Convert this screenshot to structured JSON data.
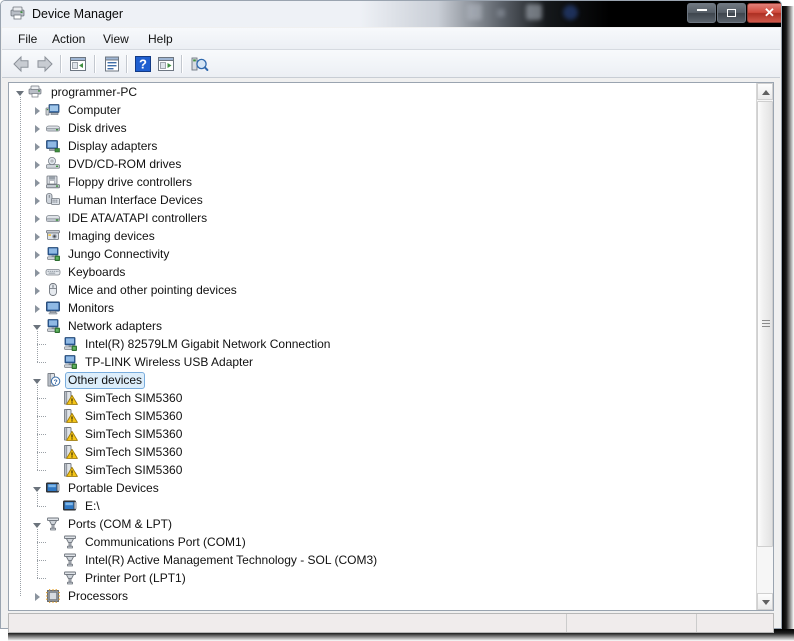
{
  "window": {
    "title": "Device Manager",
    "icon": "device-manager-icon",
    "controls": {
      "minimize": "minimize-button",
      "maximize": "maximize-button",
      "close": "close-button",
      "close_glyph": "✕"
    }
  },
  "menubar": {
    "items": [
      {
        "label": "File"
      },
      {
        "label": "Action"
      },
      {
        "label": "View"
      },
      {
        "label": "Help"
      }
    ]
  },
  "toolbar": {
    "buttons": [
      {
        "name": "back-button",
        "icon": "back-arrow-icon"
      },
      {
        "name": "forward-button",
        "icon": "forward-arrow-icon"
      },
      {
        "name": "show-hide-console-tree-button",
        "icon": "console-tree-icon"
      },
      {
        "name": "properties-button",
        "icon": "properties-icon"
      },
      {
        "name": "help-button",
        "icon": "help-question-icon"
      },
      {
        "name": "update-driver-button",
        "icon": "update-driver-icon"
      },
      {
        "name": "scan-for-hardware-changes-button",
        "icon": "scan-hardware-icon"
      }
    ]
  },
  "tree": {
    "root": {
      "label": "programmer-PC",
      "icon": "computer-root-icon",
      "state": "expanded"
    },
    "nodes": [
      {
        "label": "Computer",
        "icon": "computer-icon",
        "state": "collapsed",
        "depth": 1
      },
      {
        "label": "Disk drives",
        "icon": "disk-drive-icon",
        "state": "collapsed",
        "depth": 1
      },
      {
        "label": "Display adapters",
        "icon": "display-adapter-icon",
        "state": "collapsed",
        "depth": 1
      },
      {
        "label": "DVD/CD-ROM drives",
        "icon": "dvd-cdrom-icon",
        "state": "collapsed",
        "depth": 1
      },
      {
        "label": "Floppy drive controllers",
        "icon": "floppy-controller-icon",
        "state": "collapsed",
        "depth": 1
      },
      {
        "label": "Human Interface Devices",
        "icon": "hid-icon",
        "state": "collapsed",
        "depth": 1
      },
      {
        "label": "IDE ATA/ATAPI controllers",
        "icon": "ide-controller-icon",
        "state": "collapsed",
        "depth": 1
      },
      {
        "label": "Imaging devices",
        "icon": "imaging-device-icon",
        "state": "collapsed",
        "depth": 1
      },
      {
        "label": "Jungo Connectivity",
        "icon": "network-device-icon",
        "state": "collapsed",
        "depth": 1
      },
      {
        "label": "Keyboards",
        "icon": "keyboard-icon",
        "state": "collapsed",
        "depth": 1
      },
      {
        "label": "Mice and other pointing devices",
        "icon": "mouse-icon",
        "state": "collapsed",
        "depth": 1
      },
      {
        "label": "Monitors",
        "icon": "monitor-icon",
        "state": "collapsed",
        "depth": 1
      },
      {
        "label": "Network adapters",
        "icon": "network-adapter-icon",
        "state": "expanded",
        "depth": 1
      },
      {
        "label": "Intel(R) 82579LM Gigabit Network Connection",
        "icon": "network-adapter-icon",
        "state": "leaf",
        "depth": 2
      },
      {
        "label": "TP-LINK Wireless USB Adapter",
        "icon": "network-adapter-icon",
        "state": "leaf",
        "depth": 2
      },
      {
        "label": "Other devices",
        "icon": "unknown-device-icon",
        "state": "expanded",
        "depth": 1,
        "selected": true
      },
      {
        "label": "SimTech SIM5360",
        "icon": "unknown-device-warning-icon",
        "state": "leaf",
        "depth": 2
      },
      {
        "label": "SimTech SIM5360",
        "icon": "unknown-device-warning-icon",
        "state": "leaf",
        "depth": 2
      },
      {
        "label": "SimTech SIM5360",
        "icon": "unknown-device-warning-icon",
        "state": "leaf",
        "depth": 2
      },
      {
        "label": "SimTech SIM5360",
        "icon": "unknown-device-warning-icon",
        "state": "leaf",
        "depth": 2
      },
      {
        "label": "SimTech SIM5360",
        "icon": "unknown-device-warning-icon",
        "state": "leaf",
        "depth": 2
      },
      {
        "label": "Portable Devices",
        "icon": "portable-device-icon",
        "state": "expanded",
        "depth": 1
      },
      {
        "label": "E:\\",
        "icon": "portable-device-icon",
        "state": "leaf",
        "depth": 2
      },
      {
        "label": "Ports (COM & LPT)",
        "icon": "port-icon",
        "state": "expanded",
        "depth": 1
      },
      {
        "label": "Communications Port (COM1)",
        "icon": "port-icon",
        "state": "leaf",
        "depth": 2
      },
      {
        "label": "Intel(R) Active Management Technology - SOL (COM3)",
        "icon": "port-icon",
        "state": "leaf",
        "depth": 2
      },
      {
        "label": "Printer Port (LPT1)",
        "icon": "port-icon",
        "state": "leaf",
        "depth": 2
      },
      {
        "label": "Processors",
        "icon": "processor-icon",
        "state": "collapsed",
        "depth": 1
      }
    ]
  },
  "scrollbar": {
    "up_arrow": "scroll-up-arrow",
    "down_arrow": "scroll-down-arrow",
    "thumb": "scroll-thumb"
  },
  "statusbar": {
    "panes": [
      "",
      "",
      ""
    ]
  },
  "colors": {
    "selection_fill": "#ddeefb",
    "selection_border": "#7aaddd",
    "warning_yellow": "#f5c518",
    "titlebar_dark": "#000000",
    "close_red": "#cf4a3c"
  }
}
